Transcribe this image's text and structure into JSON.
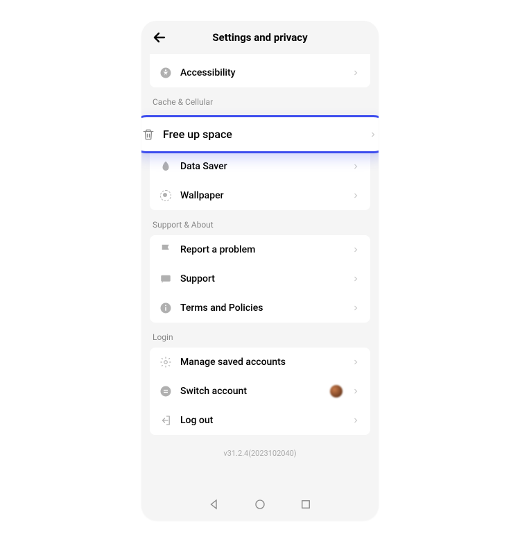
{
  "header": {
    "title": "Settings and privacy"
  },
  "sections": {
    "top": {
      "accessibility": "Accessibility"
    },
    "cache": {
      "label": "Cache & Cellular",
      "free_up_space": "Free up space",
      "data_saver": "Data Saver",
      "wallpaper": "Wallpaper"
    },
    "support": {
      "label": "Support & About",
      "report": "Report a problem",
      "support": "Support",
      "terms": "Terms and Policies"
    },
    "login": {
      "label": "Login",
      "manage": "Manage saved accounts",
      "switch": "Switch account",
      "logout": "Log out"
    }
  },
  "footer": {
    "version": "v31.2.4(2023102040)"
  }
}
